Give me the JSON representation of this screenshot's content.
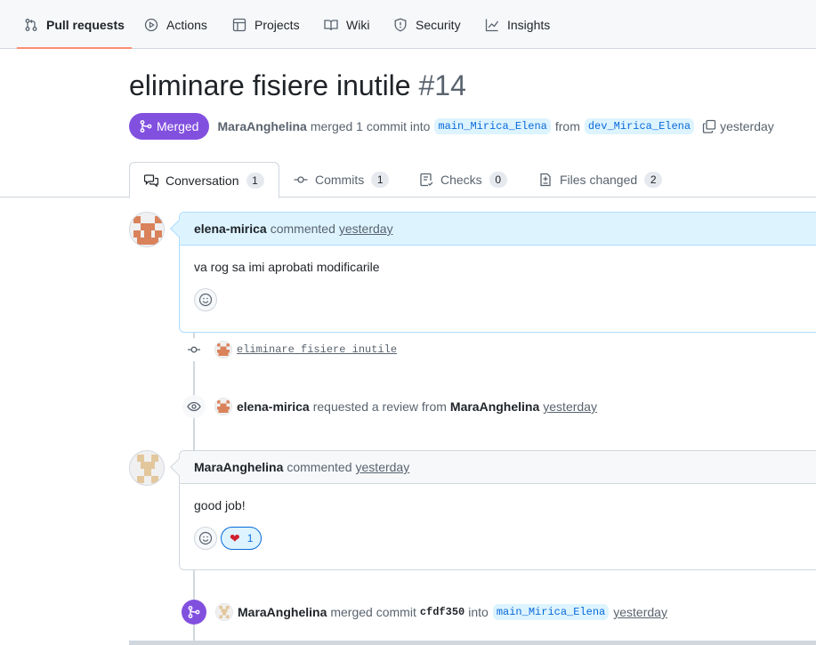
{
  "repo_nav": {
    "tabs": [
      {
        "label": "Pull requests",
        "icon": "pull-request-icon",
        "active": true
      },
      {
        "label": "Actions",
        "icon": "play-icon"
      },
      {
        "label": "Projects",
        "icon": "table-icon"
      },
      {
        "label": "Wiki",
        "icon": "book-icon"
      },
      {
        "label": "Security",
        "icon": "shield-icon"
      },
      {
        "label": "Insights",
        "icon": "graph-icon"
      }
    ]
  },
  "pr": {
    "title": "eliminare fisiere inutile",
    "number": "#14",
    "state": "Merged",
    "author": "MaraAnghelina",
    "summary": "merged 1 commit into",
    "base_branch": "main_Mirica_Elena",
    "from_text": "from",
    "head_branch": "dev_Mirica_Elena",
    "time": "yesterday"
  },
  "pr_tabs": [
    {
      "label": "Conversation",
      "count": "1",
      "icon": "comment-discussion-icon",
      "active": true
    },
    {
      "label": "Commits",
      "count": "1",
      "icon": "git-commit-icon"
    },
    {
      "label": "Checks",
      "count": "0",
      "icon": "checklist-icon"
    },
    {
      "label": "Files changed",
      "count": "2",
      "icon": "file-diff-icon"
    }
  ],
  "timeline": {
    "comment1": {
      "author": "elena-mirica",
      "action": "commented",
      "time": "yesterday",
      "body": "va rog sa imi aprobati modificarile"
    },
    "commit_event": {
      "message": "eliminare fisiere inutile"
    },
    "review_event": {
      "author": "elena-mirica",
      "text": "requested a review from",
      "reviewer": "MaraAnghelina",
      "time": "yesterday"
    },
    "comment2": {
      "author": "MaraAnghelina",
      "action": "commented",
      "time": "yesterday",
      "body": "good job!",
      "reaction": {
        "emoji": "heart",
        "count": "1"
      }
    },
    "merge_event": {
      "author": "MaraAnghelina",
      "text": "merged commit",
      "sha": "cfdf350",
      "into_text": "into",
      "branch": "main_Mirica_Elena",
      "time": "yesterday"
    }
  },
  "colors": {
    "merged": "#8250df",
    "accent_underline": "#fd8c73",
    "link": "#0969da"
  }
}
